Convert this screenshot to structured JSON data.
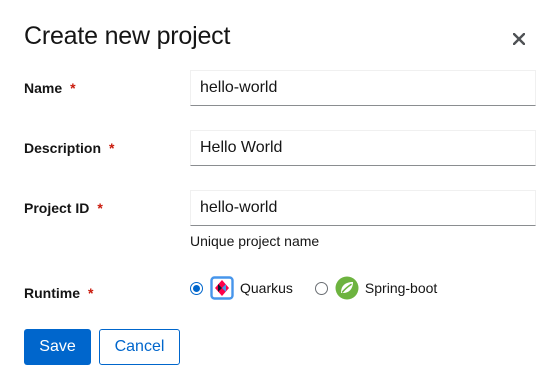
{
  "dialog": {
    "title": "Create new project"
  },
  "fields": {
    "name": {
      "label": "Name",
      "required": "*",
      "value": "hello-world"
    },
    "description": {
      "label": "Description",
      "required": "*",
      "value": "Hello World"
    },
    "project_id": {
      "label": "Project ID",
      "required": "*",
      "value": "hello-world",
      "helper": "Unique project name"
    },
    "runtime": {
      "label": "Runtime",
      "required": "*",
      "options": [
        {
          "label": "Quarkus",
          "icon": "quarkus-icon",
          "selected": true
        },
        {
          "label": "Spring-boot",
          "icon": "spring-boot-icon",
          "selected": false
        }
      ]
    }
  },
  "actions": {
    "save": "Save",
    "cancel": "Cancel"
  },
  "colors": {
    "primary": "#0066cc",
    "required": "#c9190b",
    "spring": "#6db33f",
    "quarkus_blue": "#4695eb",
    "quarkus_red": "#ff004a"
  }
}
